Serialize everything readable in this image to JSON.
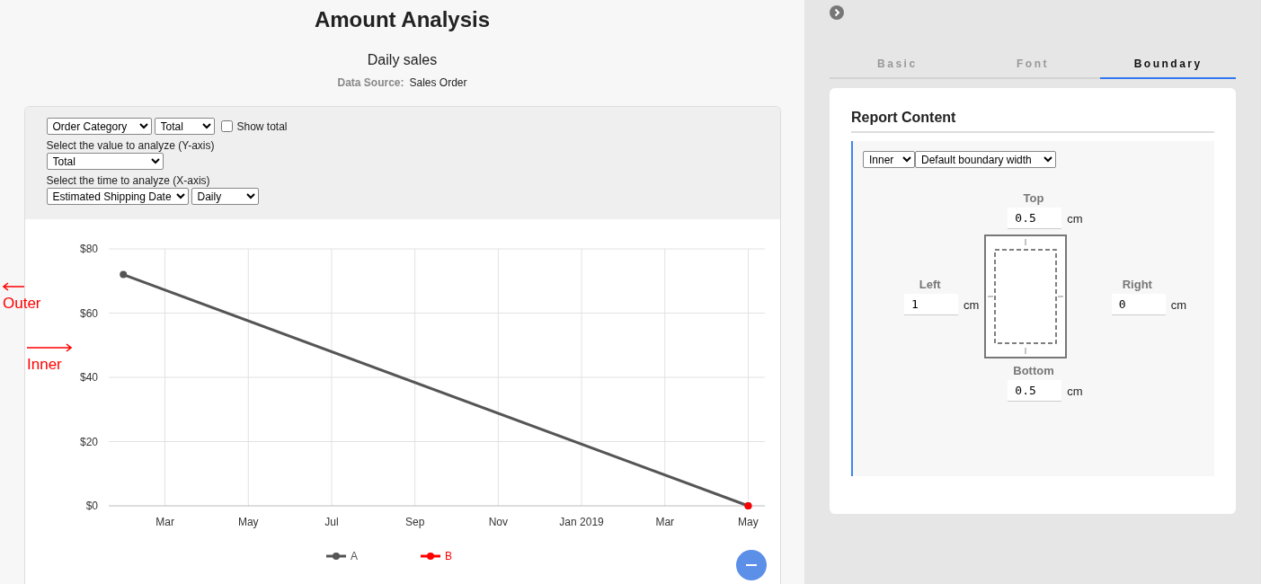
{
  "title": "Amount Analysis",
  "subtitle": "Daily sales",
  "data_source": {
    "label": "Data Source:",
    "value": "Sales Order"
  },
  "controls": {
    "group_by": "Order Category",
    "group_value": "Total",
    "show_total": {
      "label": "Show total",
      "checked": false
    },
    "y_axis": {
      "label": "Select the value to analyze (Y-axis)",
      "value": "Total"
    },
    "x_axis": {
      "label": "Select the time to analyze (X-axis)",
      "field": "Estimated Shipping Date",
      "interval": "Daily"
    }
  },
  "chart": {
    "chart_data": {
      "type": "line",
      "categories": [
        null,
        "Mar",
        null,
        "May",
        null,
        "Jul",
        null,
        "Sep",
        null,
        "Nov",
        null,
        "Jan 2019",
        null,
        "Mar",
        null,
        "May"
      ],
      "ylim": [
        0,
        80
      ],
      "grid": true,
      "legend": "bottom",
      "yticks": [
        {
          "value": 0,
          "label": "$0"
        },
        {
          "value": 20,
          "label": "$20"
        },
        {
          "value": 40,
          "label": "$40"
        },
        {
          "value": 60,
          "label": "$60"
        },
        {
          "value": 80,
          "label": "$80"
        }
      ],
      "series": [
        {
          "name": "A",
          "color": "#555555",
          "marker": true,
          "values": [
            72,
            null,
            null,
            null,
            null,
            null,
            null,
            null,
            null,
            null,
            null,
            null,
            null,
            null,
            null,
            0
          ]
        },
        {
          "name": "B",
          "color": "#ff0000",
          "marker": true,
          "values": [
            null,
            null,
            null,
            null,
            null,
            null,
            null,
            null,
            null,
            null,
            null,
            null,
            null,
            null,
            null,
            0
          ]
        }
      ]
    }
  },
  "annotations": [
    {
      "label": "Outer",
      "kind": "left-arrow"
    },
    {
      "label": "Inner",
      "kind": "right-arrow"
    }
  ],
  "panel": {
    "tabs": [
      {
        "label": "Basic",
        "selected": false
      },
      {
        "label": "Font",
        "selected": false
      },
      {
        "label": "Boundary",
        "selected": true
      }
    ],
    "section_title": "Report Content",
    "boundary_mode": "Inner",
    "boundary_width": "Default boundary width",
    "sides": [
      {
        "kind": "top",
        "label": "Top",
        "value": "0.5",
        "unit": "cm"
      },
      {
        "kind": "left",
        "label": "Left",
        "value": "1",
        "unit": "cm"
      },
      {
        "kind": "right",
        "label": "Right",
        "value": "0",
        "unit": "cm"
      },
      {
        "kind": "bottom",
        "label": "Bottom",
        "value": "0.5",
        "unit": "cm"
      }
    ]
  }
}
